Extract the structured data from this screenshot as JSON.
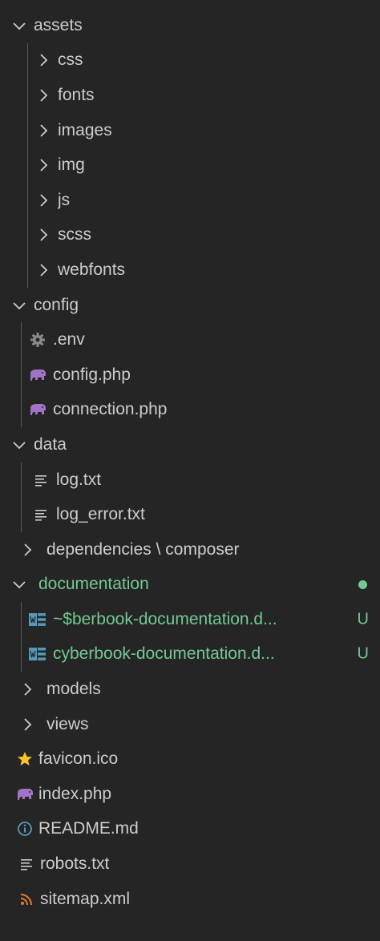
{
  "explorer": {
    "items": [
      {
        "label": "assets",
        "kind": "folder",
        "open": true,
        "depth": 0
      },
      {
        "label": "css",
        "kind": "folder",
        "open": false,
        "depth": 1
      },
      {
        "label": "fonts",
        "kind": "folder",
        "open": false,
        "depth": 1
      },
      {
        "label": "images",
        "kind": "folder",
        "open": false,
        "depth": 1
      },
      {
        "label": "img",
        "kind": "folder",
        "open": false,
        "depth": 1
      },
      {
        "label": "js",
        "kind": "folder",
        "open": false,
        "depth": 1
      },
      {
        "label": "scss",
        "kind": "folder",
        "open": false,
        "depth": 1
      },
      {
        "label": "webfonts",
        "kind": "folder",
        "open": false,
        "depth": 1
      },
      {
        "label": "config",
        "kind": "folder",
        "open": true,
        "depth": 0
      },
      {
        "label": ".env",
        "kind": "file",
        "icon": "gear-icon",
        "depth": 1
      },
      {
        "label": "config.php",
        "kind": "file",
        "icon": "php-elephant-icon",
        "depth": 1
      },
      {
        "label": "connection.php",
        "kind": "file",
        "icon": "php-elephant-icon",
        "depth": 1
      },
      {
        "label": "data",
        "kind": "folder",
        "open": true,
        "depth": 0
      },
      {
        "label": "log.txt",
        "kind": "file",
        "icon": "text-file-icon",
        "depth": 1
      },
      {
        "label": "log_error.txt",
        "kind": "file",
        "icon": "text-file-icon",
        "depth": 1
      },
      {
        "label": "dependencies \\ composer",
        "kind": "folder",
        "open": false,
        "depth": 0
      },
      {
        "label": "documentation",
        "kind": "folder",
        "open": true,
        "depth": 0,
        "status": "modified"
      },
      {
        "label": "~$berbook-documentation.d...",
        "kind": "file",
        "icon": "word-doc-icon",
        "depth": 1,
        "badge": "U"
      },
      {
        "label": "cyberbook-documentation.d...",
        "kind": "file",
        "icon": "word-doc-icon",
        "depth": 1,
        "badge": "U"
      },
      {
        "label": "models",
        "kind": "folder",
        "open": false,
        "depth": 0
      },
      {
        "label": "views",
        "kind": "folder",
        "open": false,
        "depth": 0
      },
      {
        "label": "favicon.ico",
        "kind": "file",
        "icon": "star-icon",
        "depth": 0
      },
      {
        "label": "index.php",
        "kind": "file",
        "icon": "php-elephant-icon",
        "depth": 0
      },
      {
        "label": "README.md",
        "kind": "file",
        "icon": "info-icon",
        "depth": 0
      },
      {
        "label": "robots.txt",
        "kind": "file",
        "icon": "text-file-icon",
        "depth": 0
      },
      {
        "label": "sitemap.xml",
        "kind": "file",
        "icon": "rss-icon",
        "depth": 0
      }
    ]
  },
  "colors": {
    "background": "#252526",
    "text": "#cccccc",
    "git_untracked": "#73c991",
    "php_icon": "#a074c4",
    "doc_icon": "#519aba",
    "star_icon": "#f7c325",
    "rss_icon": "#e37933",
    "guide_line": "#585858"
  }
}
